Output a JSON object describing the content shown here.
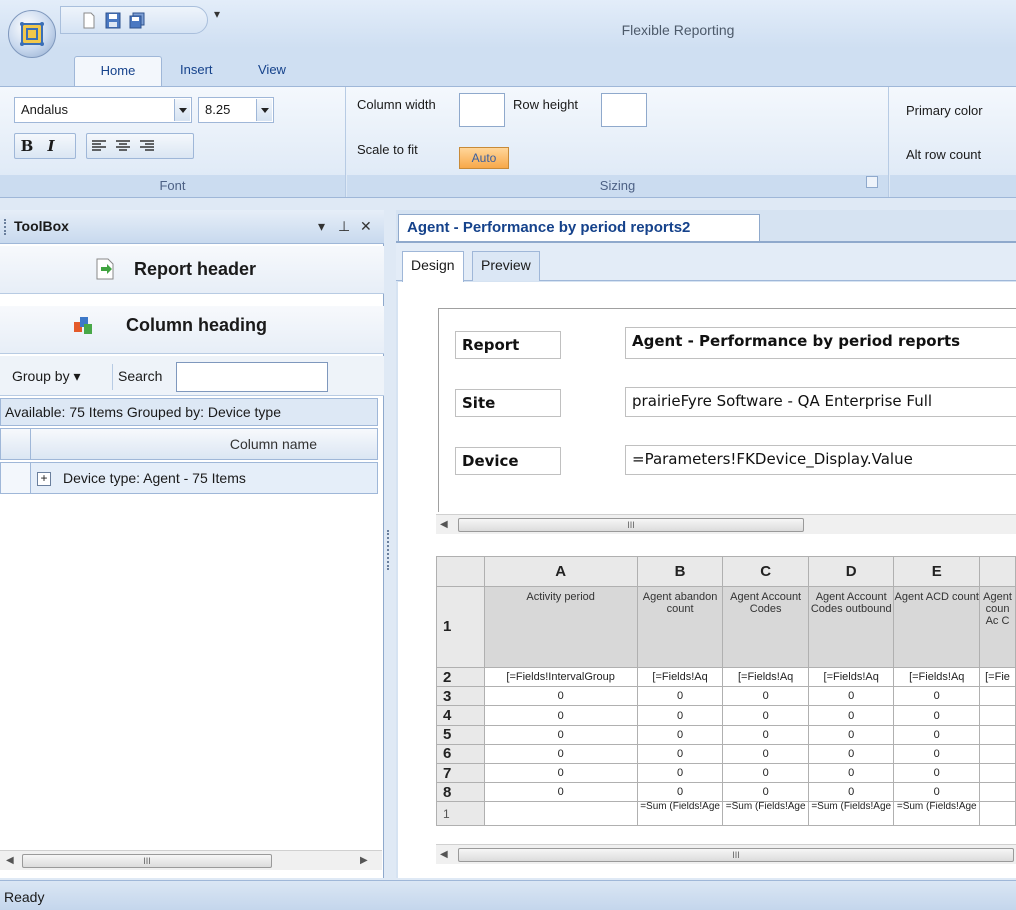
{
  "window": {
    "title": "Flexible Reporting"
  },
  "ribbon": {
    "tabs": [
      "Home",
      "Insert",
      "View"
    ],
    "font_group": {
      "label": "Font",
      "font_name": "Andalus",
      "font_size": "8.25"
    },
    "sizing_group": {
      "label": "Sizing",
      "column_width_label": "Column width",
      "row_height_label": "Row height",
      "scale_to_fit_label": "Scale to fit",
      "auto_label": "Auto"
    },
    "style_group": {
      "primary_color_label": "Primary color",
      "alt_row_count_label": "Alt row count"
    }
  },
  "toolbox": {
    "title": "ToolBox",
    "report_header": "Report header",
    "column_heading": "Column heading",
    "group_by": "Group by",
    "search_label": "Search",
    "search_value": "",
    "available": "Available: 75 Items Grouped by: Device type",
    "column_name_header": "Column name",
    "group_row": "Device type: Agent - 75 Items"
  },
  "document": {
    "tab_title": "Agent - Performance by period reports2",
    "subtabs": [
      "Design",
      "Preview"
    ],
    "header": {
      "report_label": "Report",
      "report_value": "Agent - Performance by period reports",
      "site_label": "Site",
      "site_value": "prairieFyre Software - QA Enterprise Full",
      "device_label": "Device",
      "device_value": "=Parameters!FKDevice_Display.Value"
    },
    "sheet": {
      "columns": [
        "A",
        "B",
        "C",
        "D",
        "E"
      ],
      "headers": [
        "Activity period",
        "Agent abandon count",
        "Agent Account Codes",
        "Agent Account Codes outbound",
        "Agent ACD count",
        "Agent coun Ac C"
      ],
      "row2": [
        "[=Fields!IntervalGroup",
        "[=Fields!Aq",
        "[=Fields!Aq",
        "[=Fields!Aq",
        "[=Fields!Aq",
        "[=Fie"
      ],
      "zero": "0",
      "sum": "=Sum (Fields!Age",
      "row_numbers": [
        "1",
        "2",
        "3",
        "4",
        "5",
        "6",
        "7",
        "8",
        "1"
      ]
    }
  },
  "status": {
    "text": "Ready"
  }
}
